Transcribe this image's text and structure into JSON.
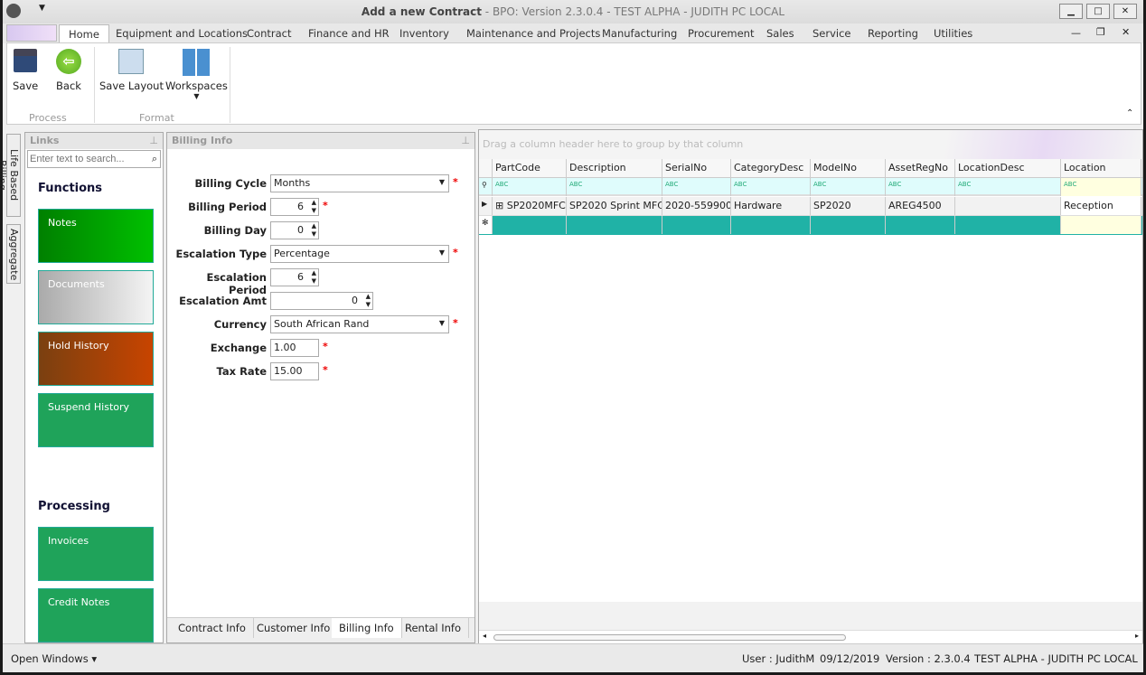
{
  "window": {
    "title_bold": "Add a new Contract",
    "title_rest": " - BPO: Version 2.3.0.4 - TEST ALPHA - JUDITH PC LOCAL",
    "minimize": "▁",
    "maximize": "□",
    "close": "✕"
  },
  "tabs": [
    "Home",
    "Equipment and Locations",
    "Contract",
    "Finance and HR",
    "Inventory",
    "Maintenance and Projects",
    "Manufacturing",
    "Procurement",
    "Sales",
    "Service",
    "Reporting",
    "Utilities"
  ],
  "ribbon": {
    "save": "Save",
    "back": "Back",
    "save_layout": "Save Layout",
    "workspaces": "Workspaces",
    "group_process": "Process",
    "group_format": "Format"
  },
  "side_tabs": [
    "Life Based Billing",
    "Aggregate"
  ],
  "links": {
    "title": "Links",
    "search_placeholder": "Enter text to search...",
    "functions_heading": "Functions",
    "functions": [
      "Notes",
      "Documents",
      "Hold History",
      "Suspend History"
    ],
    "processing_heading": "Processing",
    "processing": [
      "Invoices",
      "Credit Notes"
    ]
  },
  "billing": {
    "title": "Billing Info",
    "fields": [
      {
        "label": "Billing Cycle",
        "value": "Months",
        "type": "dropdown",
        "required": true
      },
      {
        "label": "Billing Period",
        "value": "6",
        "type": "spin",
        "required": true
      },
      {
        "label": "Billing Day",
        "value": "0",
        "type": "spin",
        "required": false
      },
      {
        "label": "Escalation Type",
        "value": "Percentage",
        "type": "dropdown",
        "required": true
      },
      {
        "label": "Escalation Period",
        "value": "6",
        "type": "spin",
        "required": false
      },
      {
        "label": "Escalation Amt",
        "value": "0",
        "type": "spinwide",
        "required": false
      },
      {
        "label": "Currency",
        "value": "South African Rand",
        "type": "dropdown",
        "required": true
      },
      {
        "label": "Exchange",
        "value": "1.00",
        "type": "text",
        "required": true
      },
      {
        "label": "Tax Rate",
        "value": "15.00",
        "type": "text",
        "required": true
      }
    ],
    "bottom_tabs": [
      "Contract Info",
      "Customer Info",
      "Billing Info",
      "Rental Info"
    ],
    "active_tab": "Billing Info"
  },
  "grid": {
    "group_hint": "Drag a column header here to group by that column",
    "columns": [
      "PartCode",
      "Description",
      "SerialNo",
      "CategoryDesc",
      "ModelNo",
      "AssetRegNo",
      "LocationDesc",
      "Location"
    ],
    "rows": [
      [
        "SP2020MFC",
        "SP2020 Sprint MFC",
        "2020-559900",
        "Hardware",
        "SP2020",
        "AREG4500",
        "",
        "Reception"
      ]
    ],
    "filter_glyph": "ABC"
  },
  "status": {
    "open_windows": "Open Windows ▾",
    "user": "User : JudithM",
    "date": "09/12/2019",
    "version": "Version : 2.3.0.4",
    "env": "TEST ALPHA - JUDITH PC LOCAL"
  },
  "colors": {
    "new_row": "#20b2a6",
    "filter_row": "#dffcfc",
    "notes": "#00a000",
    "hold": "#b84000",
    "tile_green": "#1fa35a"
  }
}
